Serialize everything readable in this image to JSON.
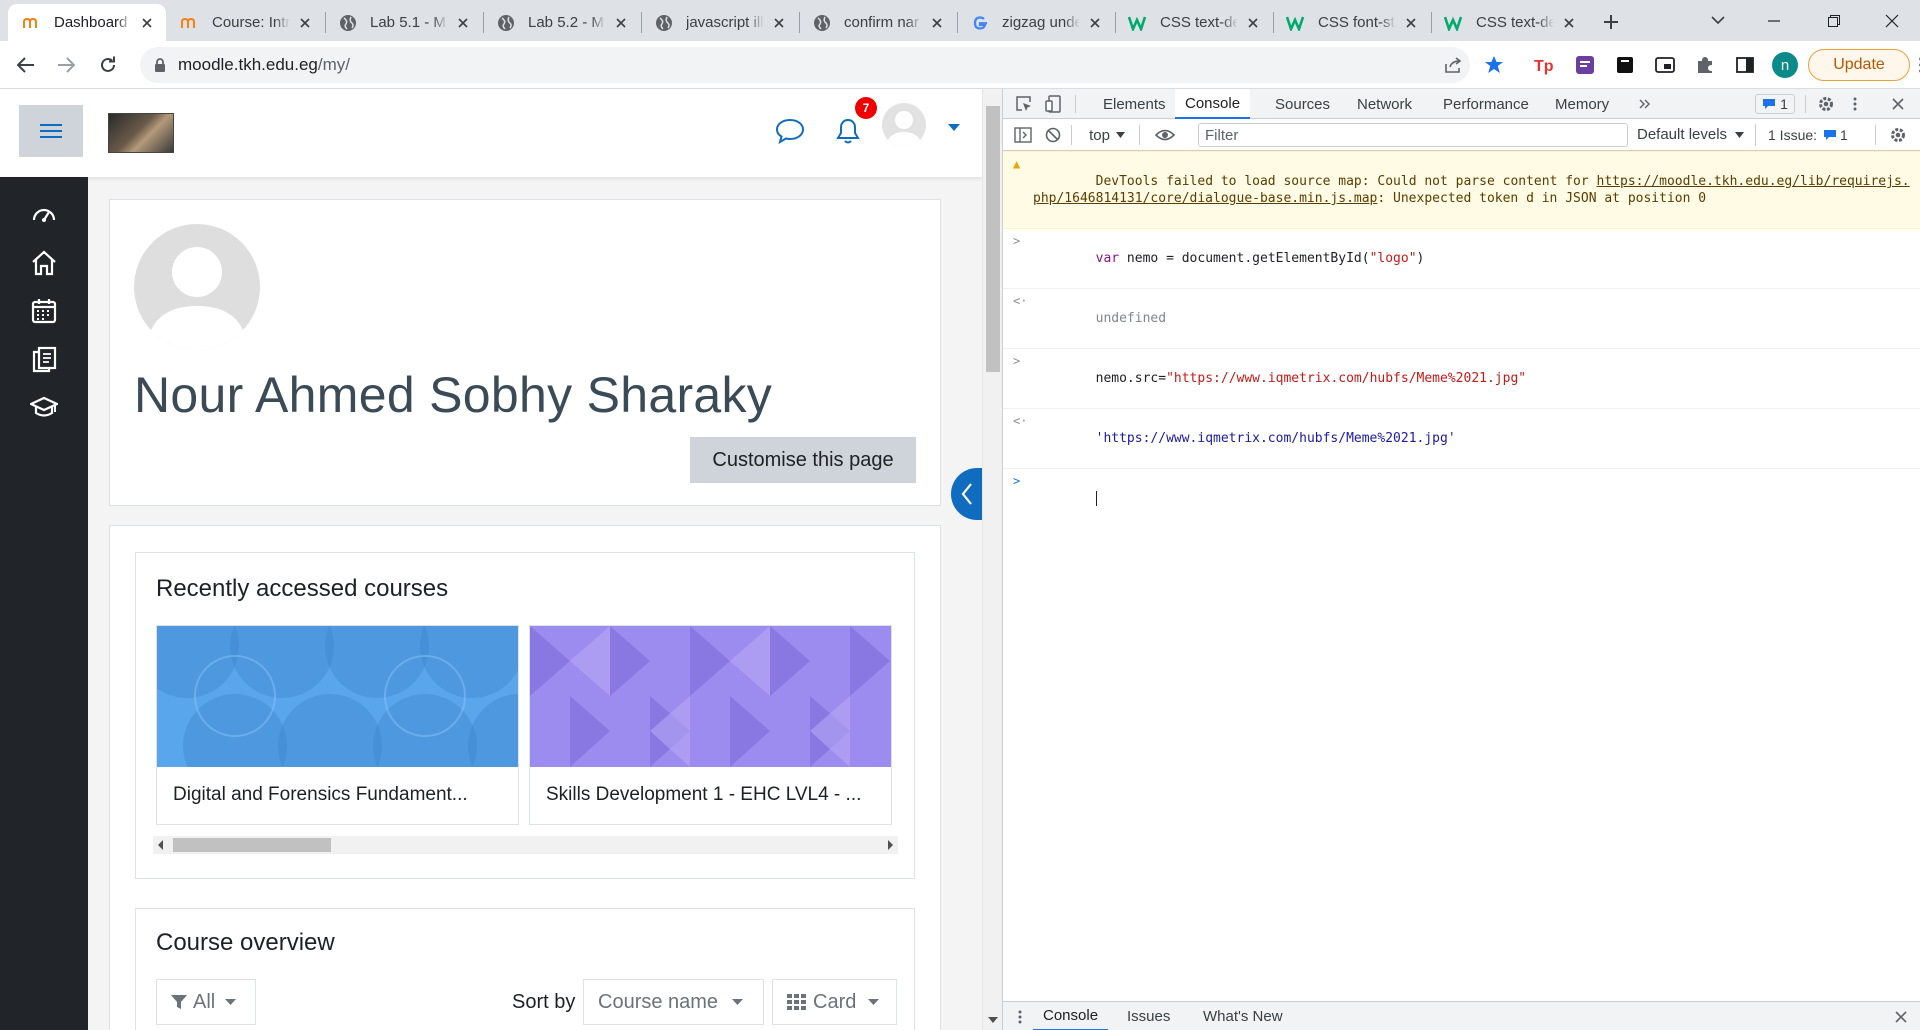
{
  "browser": {
    "tabs": [
      {
        "title": "Dashboard",
        "icon": "moodle-icon",
        "active": true
      },
      {
        "title": "Course: Intr",
        "icon": "moodle-icon"
      },
      {
        "title": "Lab 5.1 - M",
        "icon": "globe-icon"
      },
      {
        "title": "Lab 5.2 - M",
        "icon": "globe-icon"
      },
      {
        "title": "javascript ill",
        "icon": "globe-icon"
      },
      {
        "title": "confirm nar",
        "icon": "globe-icon"
      },
      {
        "title": "zigzag unde",
        "icon": "google-icon"
      },
      {
        "title": "CSS text-de",
        "icon": "w3schools-icon"
      },
      {
        "title": "CSS font-st",
        "icon": "w3schools-icon"
      },
      {
        "title": "CSS text-de",
        "icon": "w3schools-icon"
      }
    ],
    "url_host": "moodle.tkh.edu.eg",
    "url_path": "/my/",
    "profile_initial": "n",
    "update_label": "Update"
  },
  "moodle": {
    "notification_count": "7",
    "user_name": "Nour Ahmed Sobhy Sharaky",
    "customise_label": "Customise this page",
    "recent_title": "Recently accessed courses",
    "courses": [
      {
        "name": "Digital and Forensics Fundament...",
        "color": "#5aa6ec"
      },
      {
        "name": "Skills Development 1 - EHC LVL4 - ...",
        "color": "#9d8cf0"
      }
    ],
    "overview_title": "Course overview",
    "filter_label": "All",
    "sort_label": "Sort by",
    "sort_value": "Course name",
    "view_value": "Card",
    "sidebar_icons": [
      "dashboard-icon",
      "home-icon",
      "calendar-icon",
      "private-files-icon",
      "courses-icon"
    ]
  },
  "devtools": {
    "tabs": [
      "Elements",
      "Console",
      "Sources",
      "Network",
      "Performance",
      "Memory"
    ],
    "active_tab": "Console",
    "message_count": "1",
    "context": "top",
    "filter_placeholder": "Filter",
    "levels_label": "Default levels",
    "issues_label": "1 Issue:",
    "issues_count": "1",
    "warning": {
      "prefix": "DevTools failed to load source map: Could not parse content for ",
      "url": "https://moodle.tkh.edu.eg/lib/requirejs.php/1646814131/core/dialogue-base.min.js.map",
      "suffix": ": Unexpected token d in JSON at position 0"
    },
    "lines": [
      {
        "kind": "input",
        "keyword": "var",
        "code": " nemo = document.getElementById(",
        "string": "\"logo\"",
        "tail": ")"
      },
      {
        "kind": "result",
        "text": "undefined"
      },
      {
        "kind": "input",
        "keyword": "",
        "code": "nemo.src=",
        "string": "\"https://www.iqmetrix.com/hubfs/Meme%2021.jpg\"",
        "tail": ""
      },
      {
        "kind": "result-string",
        "text": "'https://www.iqmetrix.com/hubfs/Meme%2021.jpg'"
      }
    ],
    "drawer_tabs": [
      "Console",
      "Issues",
      "What's New"
    ]
  }
}
